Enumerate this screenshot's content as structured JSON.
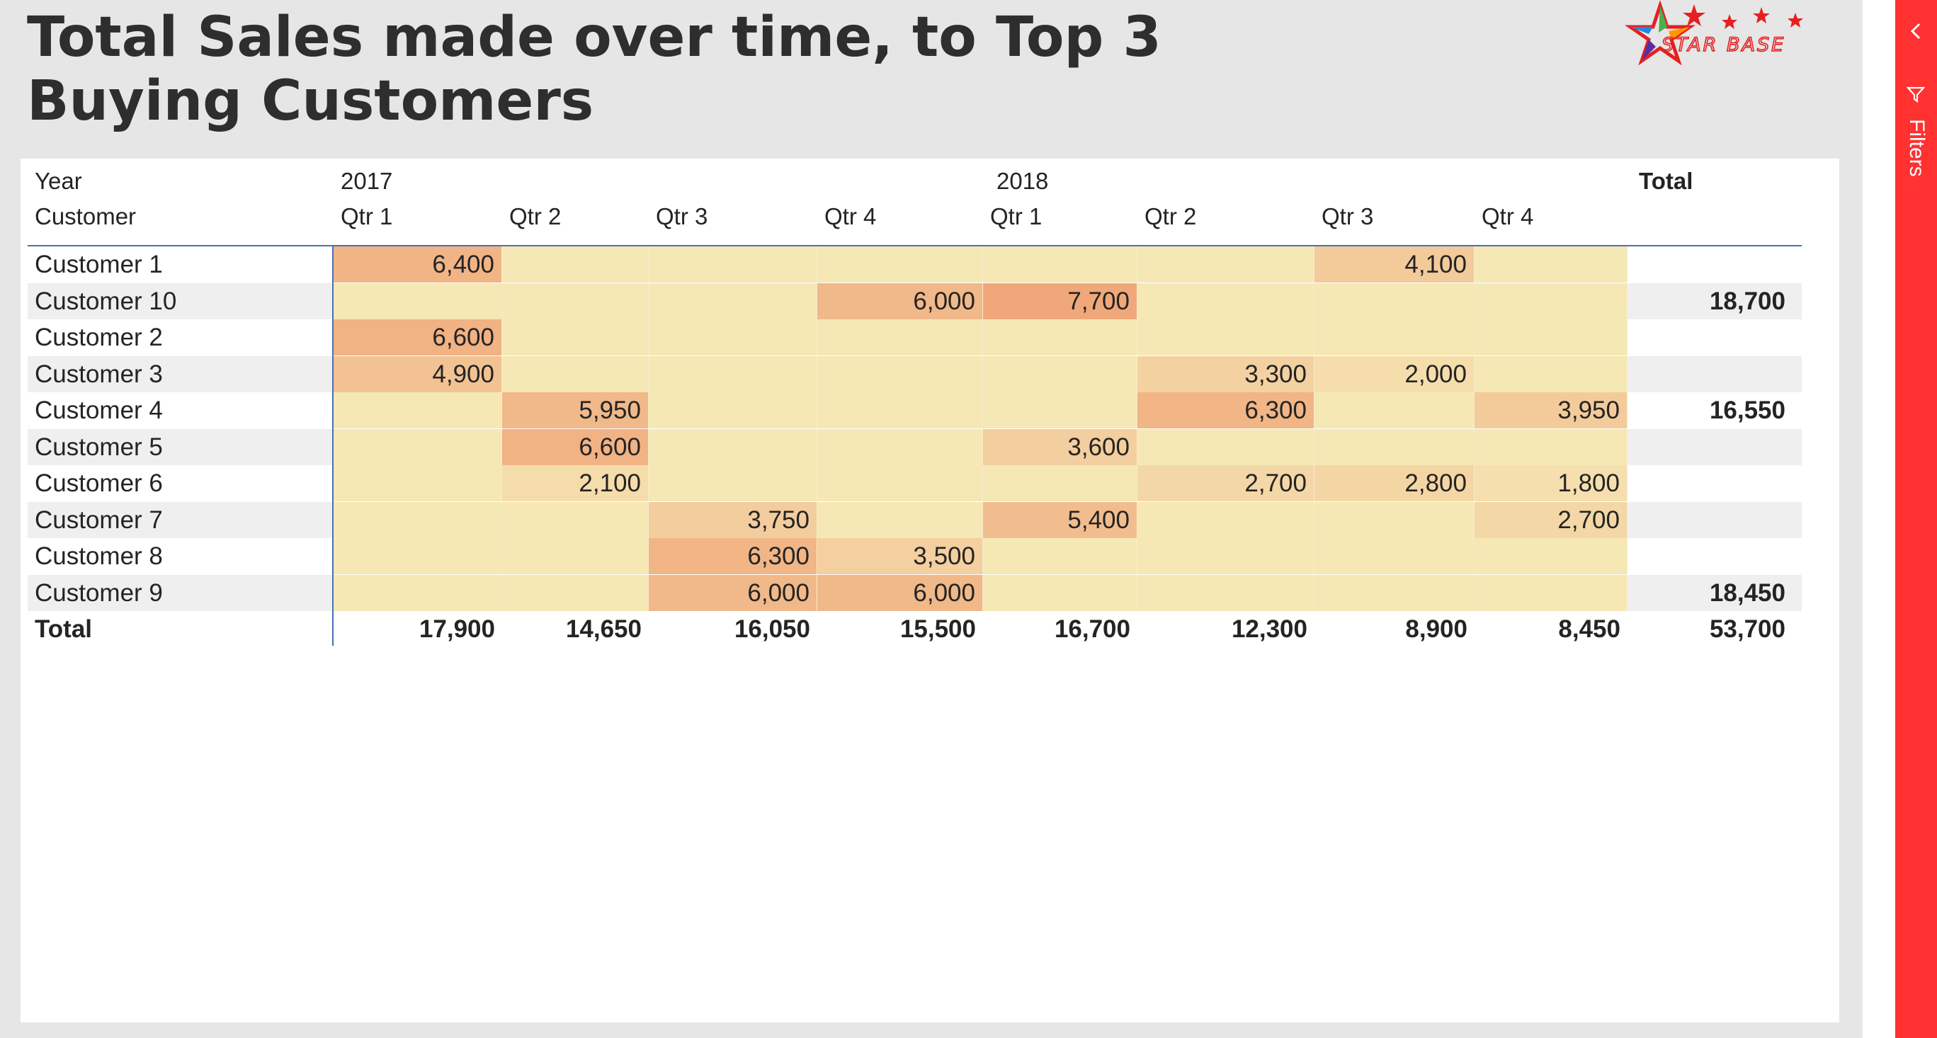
{
  "report": {
    "title": "Total Sales made over time, to Top 3 Buying Customers",
    "logo_text": "STAR BASE"
  },
  "filters_pane": {
    "label": "Filters"
  },
  "matrix": {
    "header_year_label": "Year",
    "header_customer_label": "Customer",
    "total_label": "Total",
    "years": [
      "2017",
      "2018"
    ],
    "quarters": [
      "Qtr 1",
      "Qtr 2",
      "Qtr 3",
      "Qtr 4",
      "Qtr 1",
      "Qtr 2",
      "Qtr 3",
      "Qtr 4"
    ],
    "rows": [
      {
        "customer": "Customer 1",
        "values": [
          "6,400",
          "",
          "",
          "",
          "",
          "",
          "4,100",
          ""
        ],
        "total": ""
      },
      {
        "customer": "Customer 10",
        "values": [
          "",
          "",
          "",
          "6,000",
          "7,700",
          "",
          "",
          ""
        ],
        "total": "18,700"
      },
      {
        "customer": "Customer 2",
        "values": [
          "6,600",
          "",
          "",
          "",
          "",
          "",
          "",
          ""
        ],
        "total": ""
      },
      {
        "customer": "Customer 3",
        "values": [
          "4,900",
          "",
          "",
          "",
          "",
          "3,300",
          "2,000",
          ""
        ],
        "total": ""
      },
      {
        "customer": "Customer 4",
        "values": [
          "",
          "5,950",
          "",
          "",
          "",
          "6,300",
          "",
          "3,950"
        ],
        "total": "16,550"
      },
      {
        "customer": "Customer 5",
        "values": [
          "",
          "6,600",
          "",
          "",
          "3,600",
          "",
          "",
          ""
        ],
        "total": ""
      },
      {
        "customer": "Customer 6",
        "values": [
          "",
          "2,100",
          "",
          "",
          "",
          "2,700",
          "2,800",
          "1,800"
        ],
        "total": ""
      },
      {
        "customer": "Customer 7",
        "values": [
          "",
          "",
          "3,750",
          "",
          "5,400",
          "",
          "",
          "2,700"
        ],
        "total": ""
      },
      {
        "customer": "Customer 8",
        "values": [
          "",
          "",
          "6,300",
          "3,500",
          "",
          "",
          "",
          ""
        ],
        "total": ""
      },
      {
        "customer": "Customer 9",
        "values": [
          "",
          "",
          "6,000",
          "6,000",
          "",
          "",
          "",
          ""
        ],
        "total": "18,450"
      }
    ],
    "totals": {
      "label": "Total",
      "values": [
        "17,900",
        "14,650",
        "16,050",
        "15,500",
        "16,700",
        "12,300",
        "8,900",
        "8,450"
      ],
      "grand_total": "53,700"
    },
    "heatmap_colors": {
      "empty": "#f5e8b5",
      "low": "#f5dfae",
      "high": "#f0a87a"
    }
  }
}
